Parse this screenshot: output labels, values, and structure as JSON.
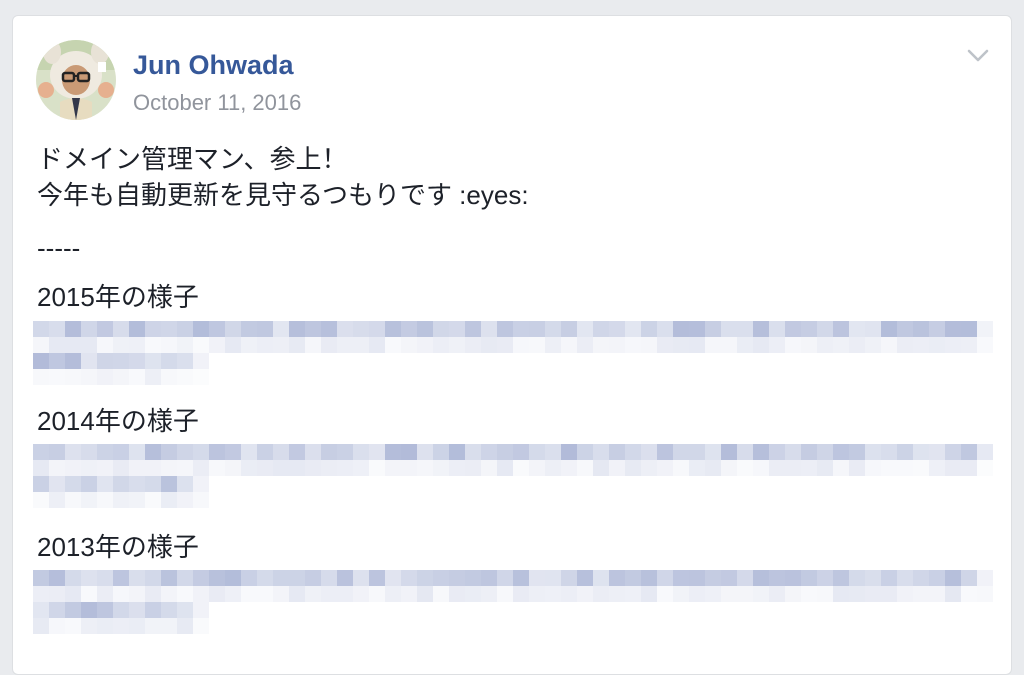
{
  "post": {
    "author": "Jun Ohwada",
    "date": "October 11, 2016",
    "lines": [
      "ドメイン管理マン、参上！",
      "今年も自動更新を見守るつもりです :eyes:"
    ],
    "separator": "-----",
    "sections": [
      {
        "heading": "2015年の様子"
      },
      {
        "heading": "2014年の様子"
      },
      {
        "heading": "2013年の様子"
      }
    ]
  },
  "colors": {
    "author": "#365899",
    "date": "#90949c",
    "text": "#1d2129",
    "blur": "#8f9dc8"
  },
  "icons": {
    "menu": "chevron-down-icon",
    "avatar": "profile-photo"
  }
}
